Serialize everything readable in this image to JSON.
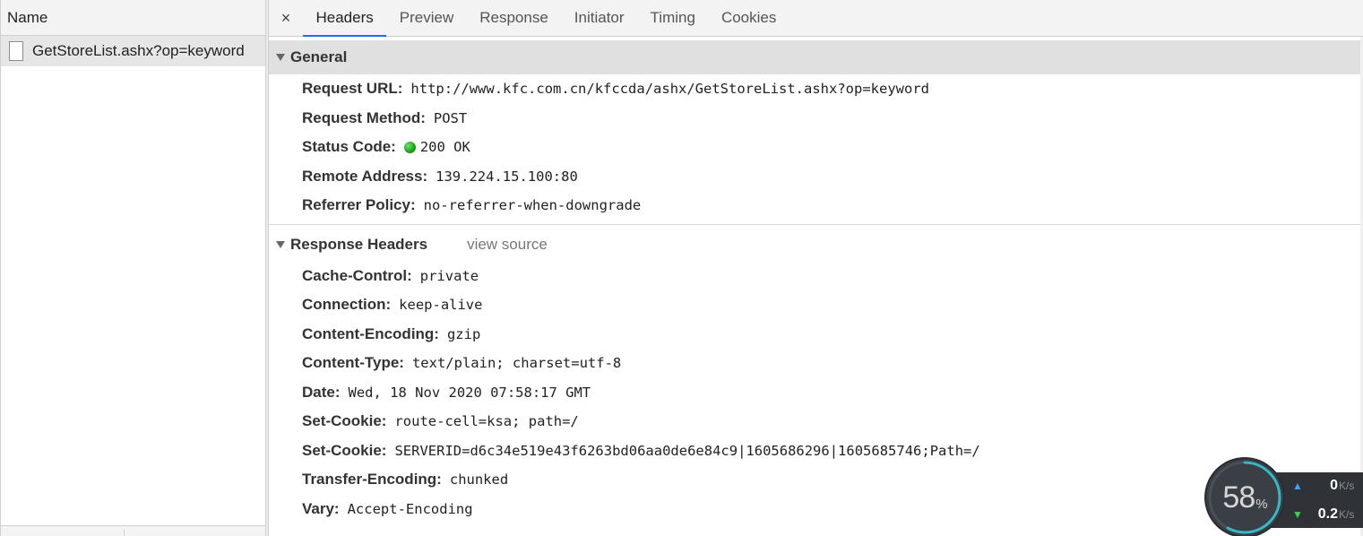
{
  "left": {
    "header": "Name",
    "requests": [
      {
        "name": "GetStoreList.ashx?op=keyword"
      }
    ]
  },
  "tabs": {
    "close_glyph": "×",
    "items": [
      "Headers",
      "Preview",
      "Response",
      "Initiator",
      "Timing",
      "Cookies"
    ],
    "active": "Headers"
  },
  "general": {
    "title": "General",
    "rows": [
      {
        "key": "Request URL:",
        "value": "http://www.kfc.com.cn/kfccda/ashx/GetStoreList.ashx?op=keyword"
      },
      {
        "key": "Request Method:",
        "value": "POST"
      },
      {
        "key": "Status Code:",
        "value": "200 OK",
        "status_color": "#16a016"
      },
      {
        "key": "Remote Address:",
        "value": "139.224.15.100:80"
      },
      {
        "key": "Referrer Policy:",
        "value": "no-referrer-when-downgrade"
      }
    ]
  },
  "response_headers": {
    "title": "Response Headers",
    "view_source": "view source",
    "rows": [
      {
        "key": "Cache-Control:",
        "value": "private"
      },
      {
        "key": "Connection:",
        "value": "keep-alive"
      },
      {
        "key": "Content-Encoding:",
        "value": "gzip"
      },
      {
        "key": "Content-Type:",
        "value": "text/plain; charset=utf-8"
      },
      {
        "key": "Date:",
        "value": "Wed, 18 Nov 2020 07:58:17 GMT"
      },
      {
        "key": "Set-Cookie:",
        "value": "route-cell=ksa; path=/"
      },
      {
        "key": "Set-Cookie:",
        "value": "SERVERID=d6c34e519e43f6263bd06aa0de6e84c9|1605686296|1605685746;Path=/"
      },
      {
        "key": "Transfer-Encoding:",
        "value": "chunked"
      },
      {
        "key": "Vary:",
        "value": "Accept-Encoding"
      }
    ]
  },
  "speed_widget": {
    "percent": "58",
    "percent_sign": "%",
    "percent_value": 58,
    "upload": {
      "value": "0",
      "unit": "K/s",
      "icon": "up-arrow-icon"
    },
    "download": {
      "value": "0.2",
      "unit": "K/s",
      "icon": "down-arrow-icon"
    },
    "colors": {
      "arc": "#35b9c9",
      "upload": "#3aa3ff",
      "download": "#3ad64a"
    }
  }
}
